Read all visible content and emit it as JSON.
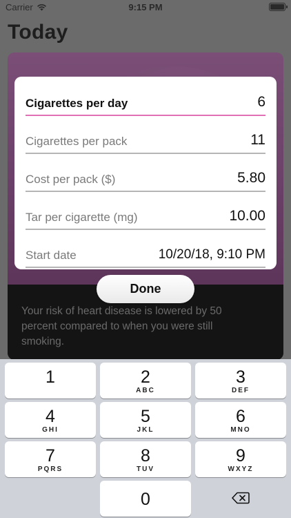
{
  "status_bar": {
    "carrier": "Carrier",
    "time": "9:15 PM"
  },
  "header": {
    "title": "Today"
  },
  "card": {
    "description": "Your risk of heart disease is lowered by 50 percent compared to when you were still smoking."
  },
  "form": {
    "fields": [
      {
        "label": "Cigarettes per day",
        "value": "6",
        "active": true
      },
      {
        "label": "Cigarettes per pack",
        "value": "11"
      },
      {
        "label": "Cost per pack ($)",
        "value": "5.80"
      },
      {
        "label": "Tar per cigarette (mg)",
        "value": "10.00"
      },
      {
        "label": "Start date",
        "value": "10/20/18, 9:10 PM"
      }
    ],
    "done_label": "Done"
  },
  "keyboard": {
    "keys": [
      {
        "num": "1",
        "letters": ""
      },
      {
        "num": "2",
        "letters": "ABC"
      },
      {
        "num": "3",
        "letters": "DEF"
      },
      {
        "num": "4",
        "letters": "GHI"
      },
      {
        "num": "5",
        "letters": "JKL"
      },
      {
        "num": "6",
        "letters": "MNO"
      },
      {
        "num": "7",
        "letters": "PQRS"
      },
      {
        "num": "8",
        "letters": "TUV"
      },
      {
        "num": "9",
        "letters": "WXYZ"
      },
      {
        "num": "0",
        "letters": ""
      }
    ],
    "backspace_icon": "delete-backspace-icon"
  },
  "colors": {
    "accent_underline": "#e06fb6",
    "card_purple": "#6a3f67",
    "keyboard_bg": "#cfd3d9"
  }
}
